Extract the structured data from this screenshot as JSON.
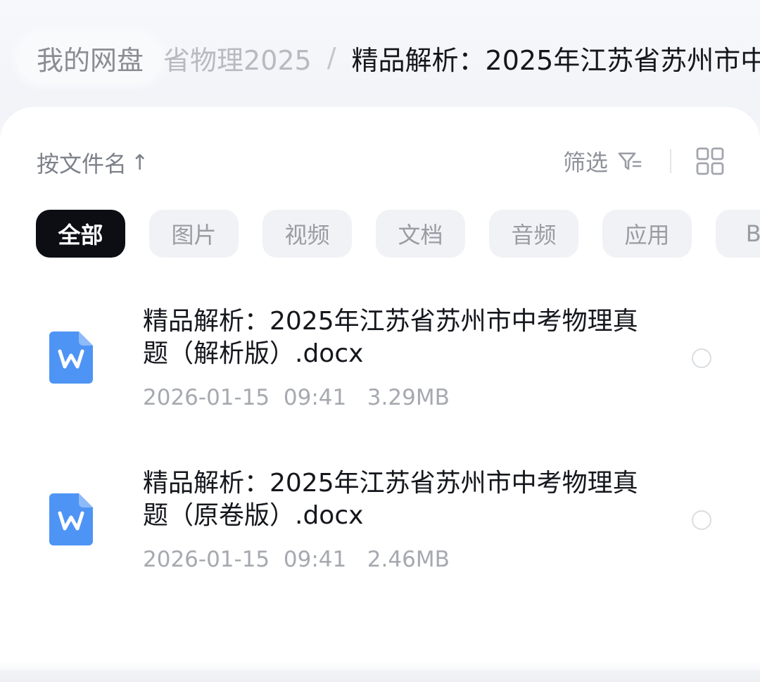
{
  "breadcrumb": {
    "home": "我的网盘",
    "parent": "省物理2025",
    "separator": "/",
    "current": "精品解析：2025年江苏省苏州市中"
  },
  "toolbar": {
    "sort_label": "按文件名",
    "sort_arrow": "↑",
    "filter_label": "筛选"
  },
  "tabs": [
    {
      "label": "全部",
      "active": true
    },
    {
      "label": "图片"
    },
    {
      "label": "视频"
    },
    {
      "label": "文档"
    },
    {
      "label": "音频"
    },
    {
      "label": "应用"
    },
    {
      "label": "BT"
    }
  ],
  "files": [
    {
      "name": "精品解析：2025年江苏省苏州市中考物理真题（解析版）.docx",
      "date": "2026-01-15",
      "time": "09:41",
      "size": "3.29MB",
      "icon": "word-doc-icon"
    },
    {
      "name": "精品解析：2025年江苏省苏州市中考物理真题（原卷版）.docx",
      "date": "2026-01-15",
      "time": "09:41",
      "size": "2.46MB",
      "icon": "word-doc-icon"
    }
  ],
  "colors": {
    "accent_doc": "#4e94f4",
    "active_tab_bg": "#0c0e14"
  }
}
